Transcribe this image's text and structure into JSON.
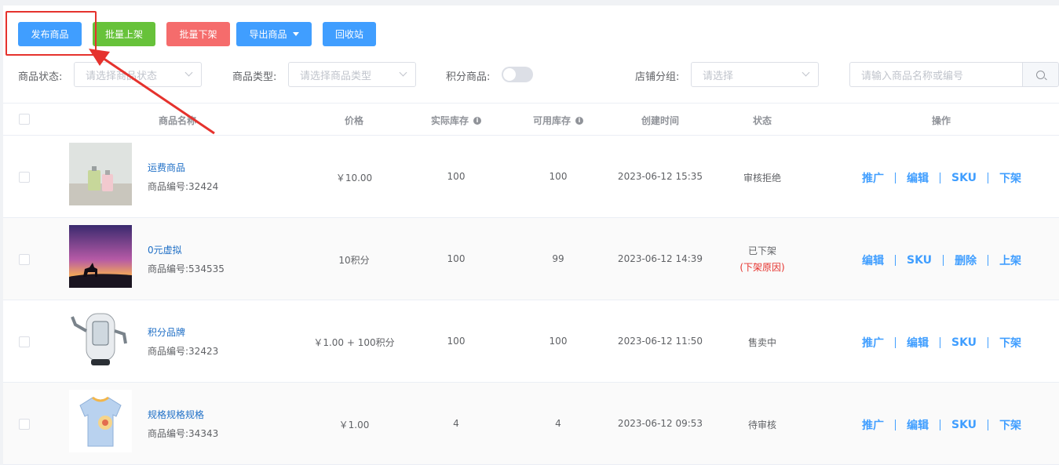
{
  "toolbar": {
    "publish": "发布商品",
    "batch_on": "批量上架",
    "batch_off": "批量下架",
    "export": "导出商品",
    "recycle": "回收站"
  },
  "filters": {
    "status_label": "商品状态:",
    "status_placeholder": "请选择商品状态",
    "type_label": "商品类型:",
    "type_placeholder": "请选择商品类型",
    "points_label": "积分商品:",
    "group_label": "店铺分组:",
    "group_placeholder": "请选择",
    "search_placeholder": "请输入商品名称或编号"
  },
  "table": {
    "headers": {
      "name": "商品名称",
      "price": "价格",
      "actual_stock": "实际库存",
      "available_stock": "可用库存",
      "created": "创建时间",
      "status": "状态",
      "actions": "操作"
    },
    "rows": [
      {
        "name": "运费商品",
        "code": "商品编号:32424",
        "price": "￥10.00",
        "actual_stock": "100",
        "available_stock": "100",
        "created": "2023-06-12 15:35",
        "status": "审核拒绝",
        "actions": [
          "推广",
          "编辑",
          "SKU",
          "下架"
        ]
      },
      {
        "name": "0元虚拟",
        "code": "商品编号:534535",
        "price": "10积分",
        "actual_stock": "100",
        "available_stock": "99",
        "created": "2023-06-12 14:39",
        "status": "已下架",
        "status_reason": "(下架原因)",
        "actions": [
          "编辑",
          "SKU",
          "删除",
          "上架"
        ]
      },
      {
        "name": "积分品牌",
        "code": "商品编号:32423",
        "price": "￥1.00 + 100积分",
        "actual_stock": "100",
        "available_stock": "100",
        "created": "2023-06-12 11:50",
        "status": "售卖中",
        "actions": [
          "推广",
          "编辑",
          "SKU",
          "下架"
        ]
      },
      {
        "name": "规格规格规格",
        "code": "商品编号:34343",
        "price": "￥1.00",
        "actual_stock": "4",
        "available_stock": "4",
        "created": "2023-06-12 09:53",
        "status": "待审核",
        "actions": [
          "推广",
          "编辑",
          "SKU",
          "下架"
        ]
      }
    ]
  },
  "colors": {
    "primary": "#409eff",
    "success": "#67c23a",
    "danger": "#f56c6c",
    "annotation": "#e5322d",
    "link": "#1f6fc6"
  }
}
